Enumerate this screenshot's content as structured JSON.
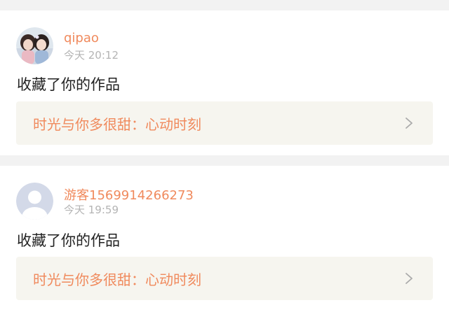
{
  "notifications": [
    {
      "avatar": "user-photo-avatar",
      "username": "qipao",
      "time": "今天 20:12",
      "action": "收藏了你的作品",
      "work_title": "时光与你多很甜：心动时刻",
      "link_icon": "chevron-right-icon"
    },
    {
      "avatar": "default-guest-avatar",
      "username": "游客1569914266273",
      "time": "今天 19:59",
      "action": "收藏了你的作品",
      "work_title": "时光与你多很甜：心动时刻",
      "link_icon": "chevron-right-icon"
    }
  ],
  "colors": {
    "accent": "#f08a5d",
    "muted": "#b4b4b4",
    "text": "#222222",
    "link_bg": "#f6f5ef",
    "page_bg": "#f2f2f2"
  }
}
